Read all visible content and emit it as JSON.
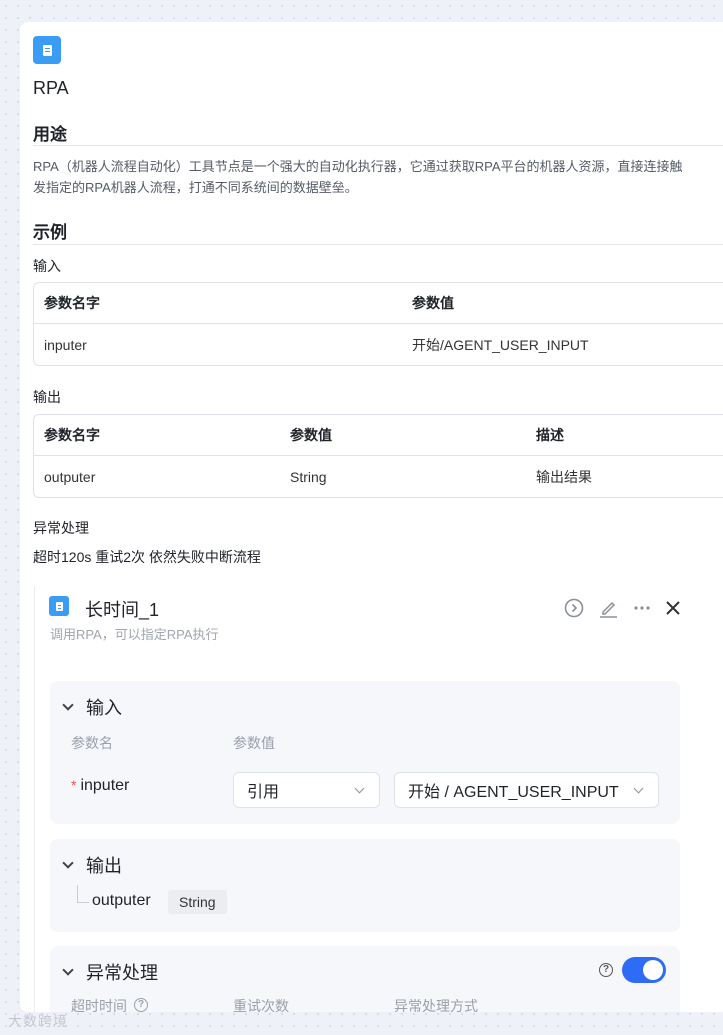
{
  "app": {
    "title": "RPA",
    "icon": "document-icon"
  },
  "purpose": {
    "heading": "用途",
    "line1": "RPA（机器人流程自动化）工具节点是一个强大的自动化执行器，它通过获取RPA平台的机器人资源，直接连接触",
    "line2": "发指定的RPA机器人流程，打通不同系统间的数据壁垒。"
  },
  "example": {
    "heading": "示例",
    "input_label": "输入",
    "input_table": {
      "headers": [
        "参数名字",
        "参数值"
      ],
      "rows": [
        [
          "inputer",
          "开始/AGENT_USER_INPUT"
        ]
      ]
    },
    "output_label": "输出",
    "output_table": {
      "headers": [
        "参数名字",
        "参数值",
        "描述"
      ],
      "rows": [
        [
          "outputer",
          "String",
          "输出结果"
        ]
      ]
    },
    "exception_label": "异常处理",
    "exception_text": "超时120s 重试2次 依然失败中断流程"
  },
  "node": {
    "title": "长时间_1",
    "subtitle": "调用RPA，可以指定RPA执行",
    "icon": "document-icon",
    "toolbar": [
      "run-icon",
      "edit-icon",
      "more-icon",
      "close-icon"
    ],
    "input_section": {
      "title": "输入",
      "col_name": "参数名",
      "col_value": "参数值",
      "param_name": "inputer",
      "required_mark": "*",
      "ref_type": "引用",
      "ref_value": "开始 / AGENT_USER_INPUT"
    },
    "output_section": {
      "title": "输出",
      "param_name": "outputer",
      "param_type": "String"
    },
    "exception_section": {
      "title": "异常处理",
      "enabled": true,
      "col_timeout": "超时时间",
      "col_retry": "重试次数",
      "col_mode": "异常处理方式"
    }
  },
  "watermark": "大数跨境",
  "colors": {
    "accent": "#2f6cf6",
    "icon_blue": "#3b9cf6",
    "required": "#f54a45"
  }
}
